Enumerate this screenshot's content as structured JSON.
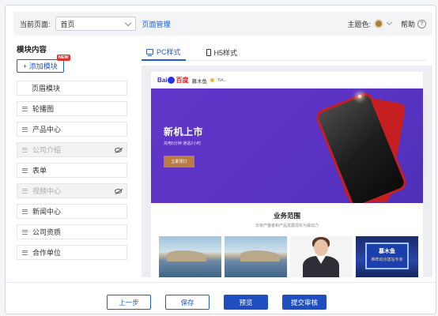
{
  "topbar": {
    "current_page_label": "当前页面:",
    "current_page_value": "首页",
    "page_mgmt_link": "页面管理",
    "theme_label": "主题色:",
    "theme_color": "#b07a3a",
    "help_label": "帮助"
  },
  "modules": {
    "title": "模块内容",
    "add_button": "+ 添加模块",
    "new_badge": "NEW",
    "items": [
      {
        "label": "页眉模块",
        "hidden": false
      },
      {
        "label": "轮播图",
        "hidden": false
      },
      {
        "label": "产品中心",
        "hidden": false
      },
      {
        "label": "公司介绍",
        "hidden": true
      },
      {
        "label": "表单",
        "hidden": false
      },
      {
        "label": "视频中心",
        "hidden": true
      },
      {
        "label": "新闻中心",
        "hidden": false
      },
      {
        "label": "公司资质",
        "hidden": false
      },
      {
        "label": "合作单位",
        "hidden": false
      }
    ]
  },
  "tabs": [
    {
      "label": "PC样式",
      "icon": "monitor-icon",
      "active": true
    },
    {
      "label": "H5样式",
      "icon": "phone-icon",
      "active": false
    }
  ],
  "preview": {
    "logo_text": "Bai",
    "logo_red": "百度",
    "brand": "慕木鱼",
    "brand_tag": "TIA...",
    "banner_title": "新机上市",
    "banner_subtitle": "充电5分钟 通话2小时",
    "banner_cta": "立即预订",
    "section_title": "业务范围",
    "section_subtitle": "日夜产整者和产品发展现实为最动力",
    "sign_line1": "慕木鱼",
    "sign_line2": "推荐动点建站专家"
  },
  "footer": {
    "prev": "上一步",
    "save": "保存",
    "preview": "预览",
    "submit": "提交审核"
  },
  "colors": {
    "accent": "#1f5bd6",
    "banner": "#5a34c4",
    "phone": "#c61f21"
  }
}
